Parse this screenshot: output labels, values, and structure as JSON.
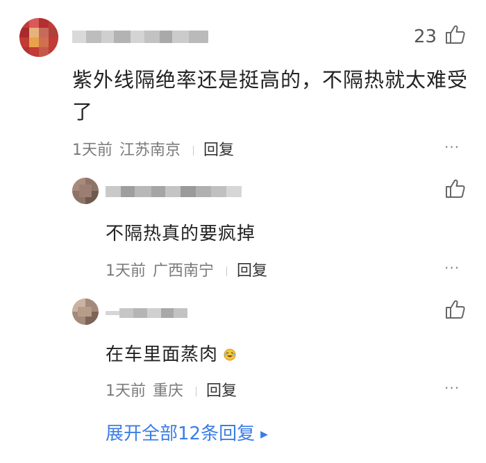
{
  "comment": {
    "likes": "23",
    "text": "紫外线隔绝率还是挺高的，不隔热就太难受了",
    "time": "1天前",
    "location": "江苏南京",
    "reply_label": "回复",
    "more_label": "···"
  },
  "replies": [
    {
      "text": "不隔热真的要疯掉",
      "time": "1天前",
      "location": "广西南宁",
      "reply_label": "回复",
      "more_label": "···"
    },
    {
      "text": "在车里面蒸肉",
      "emoji": "laughing-crying-emoji",
      "time": "1天前",
      "location": "重庆",
      "reply_label": "回复",
      "more_label": "···"
    }
  ],
  "expand_label": "展开全部12条回复",
  "colors": {
    "link": "#3b7de6",
    "meta": "#7a7a7a",
    "text": "#222222"
  },
  "icons": {
    "like": "thumbs-up-icon",
    "more": "more-dots-icon",
    "expand": "triangle-right-icon"
  }
}
